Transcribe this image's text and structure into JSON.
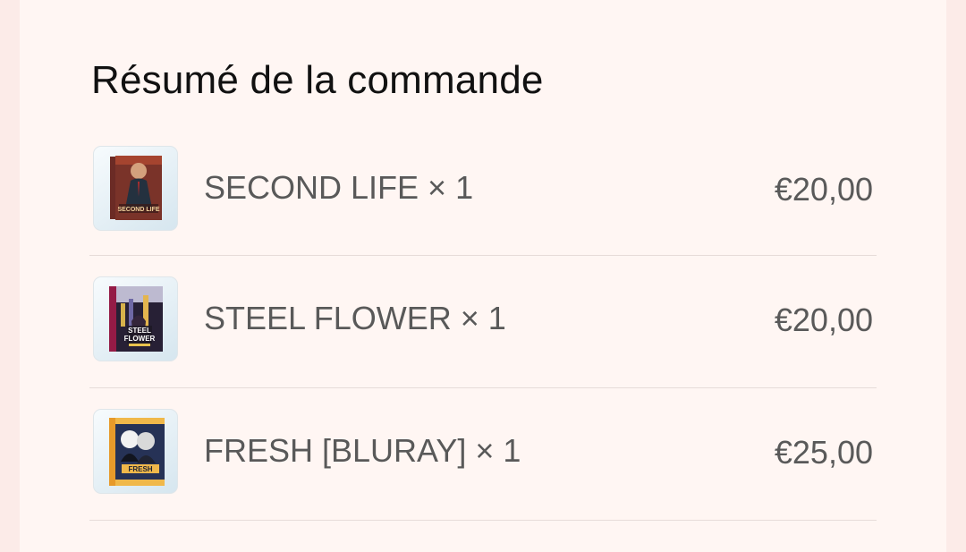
{
  "order_summary": {
    "title": "Résumé de la commande",
    "items": [
      {
        "name": "SECOND LIFE × 1",
        "price": "€20,00",
        "thumbnail_icon": "second-life-bluray-cover",
        "cover_text": "SECOND LIFE"
      },
      {
        "name": "STEEL FLOWER × 1",
        "price": "€20,00",
        "thumbnail_icon": "steel-flower-bluray-cover",
        "cover_text": "STEEL FLOWER"
      },
      {
        "name": "FRESH [BLURAY] × 1",
        "price": "€25,00",
        "thumbnail_icon": "fresh-bluray-cover",
        "cover_text": "FRESH"
      }
    ]
  },
  "colors": {
    "page_background": "#fcebe8",
    "panel_background": "#fff6f3",
    "title_text": "#111111",
    "item_text": "#595959",
    "divider": "#e7dcd9"
  }
}
